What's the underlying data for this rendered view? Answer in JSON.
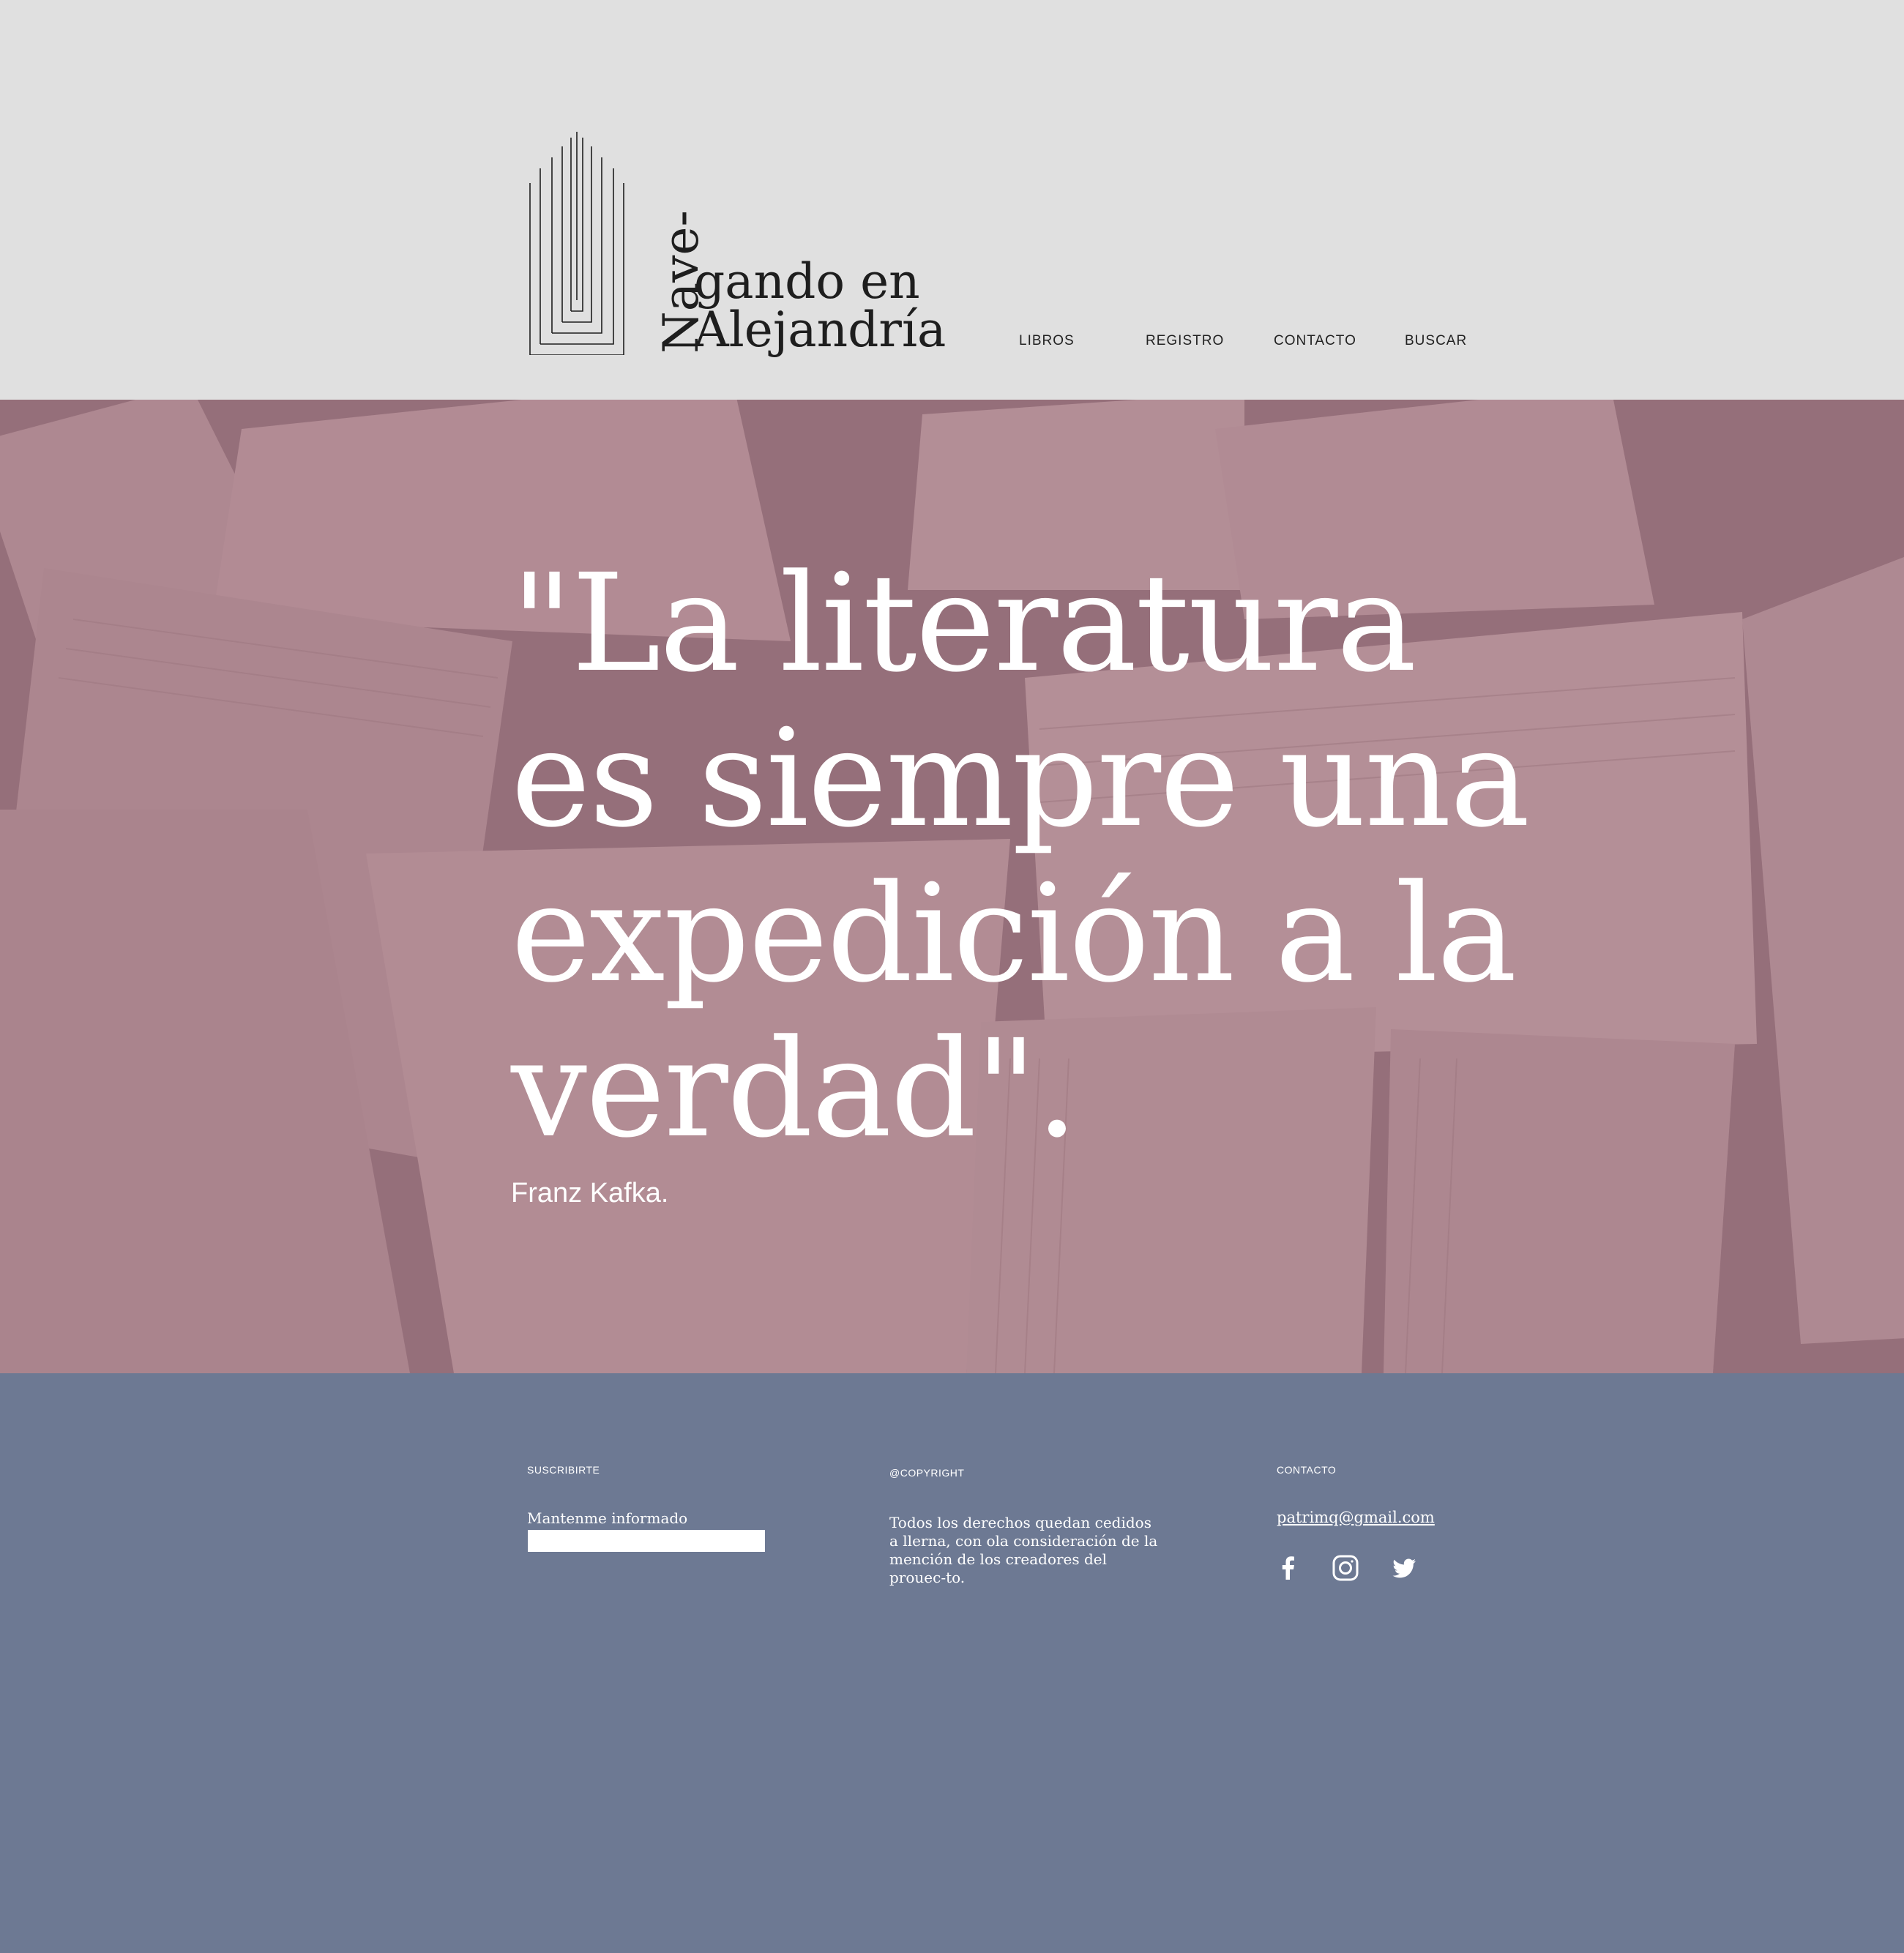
{
  "header": {
    "logo": {
      "vertical_text": "Nave-",
      "line1": "gando en",
      "line2": "Alejandría"
    },
    "nav": [
      "LIBROS",
      "REGISTRO",
      "CONTACTO",
      "BUSCAR"
    ]
  },
  "hero": {
    "quote": "\"La literatura es siempre una expedición a la verdad\".",
    "author": "Franz Kafka."
  },
  "footer": {
    "subscribe": {
      "heading": "SUSCRIBIRTE",
      "label": "Mantenme informado",
      "input_value": ""
    },
    "copyright": {
      "heading": "@COPYRIGHT",
      "text": "Todos los derechos quedan cedidos a llerna, con ola consideración de la mención de los creadores del prouec-to."
    },
    "contact": {
      "heading": "CONTACTO",
      "email": "patrimq@gmail.com",
      "social": [
        "facebook-icon",
        "instagram-icon",
        "twitter-icon"
      ]
    }
  },
  "colors": {
    "header_bg": "#e0e0e0",
    "hero_tint": "#a7848d",
    "footer_bg": "#6d7993",
    "text_dark": "#1e1e1e",
    "text_light": "#ffffff"
  }
}
